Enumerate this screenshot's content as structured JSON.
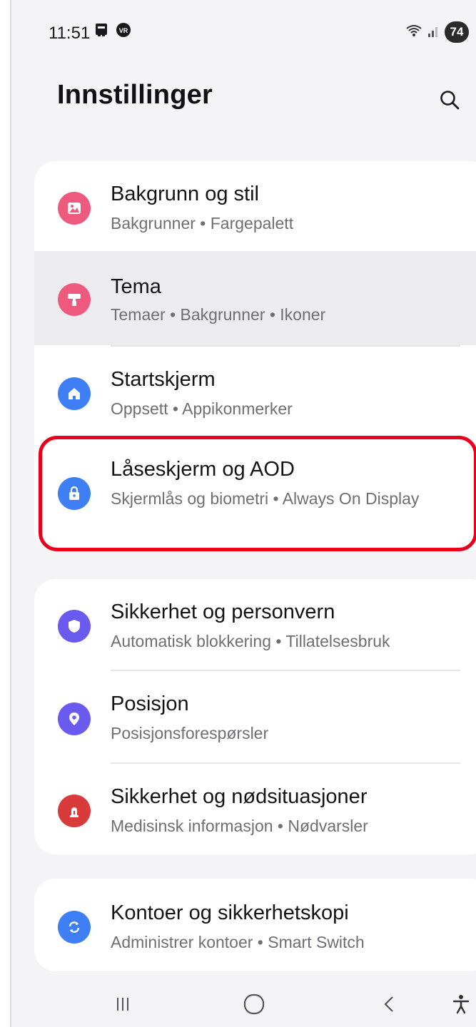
{
  "status_bar": {
    "time": "11:51",
    "battery": "74",
    "notification_icons": [
      "sim-card-icon",
      "vr-badge-icon"
    ],
    "system_icons": [
      "wifi-icon",
      "signal-icon",
      "battery-icon"
    ]
  },
  "header": {
    "title": "Innstillinger",
    "search_icon": "search-icon"
  },
  "groups": [
    {
      "items": [
        {
          "title": "Bakgrunn og stil",
          "subtitle": "Bakgrunner • Fargepalett",
          "icon": "image-icon",
          "color": "#ee5a7e"
        },
        {
          "title": "Tema",
          "subtitle": "Temaer • Bakgrunner • Ikoner",
          "icon": "paint-roller-icon",
          "color": "#ee5a7e"
        },
        {
          "title": "Startskjerm",
          "subtitle": "Oppsett • Appikonmerker",
          "icon": "home-icon",
          "color": "#3f7ff5"
        },
        {
          "title": "Låseskjerm og AOD",
          "subtitle": "Skjermlås og biometri • Always On Display",
          "icon": "lock-icon",
          "color": "#3f7ff5"
        }
      ]
    },
    {
      "items": [
        {
          "title": "Sikkerhet og personvern",
          "subtitle": "Automatisk blokkering • Tillatelsesbruk",
          "icon": "shield-icon",
          "color": "#6a5af0"
        },
        {
          "title": "Posisjon",
          "subtitle": "Posisjonsforespørsler",
          "icon": "location-pin-icon",
          "color": "#6a5af0"
        },
        {
          "title": "Sikkerhet og nødsituasjoner",
          "subtitle": "Medisinsk informasjon • Nødvarsler",
          "icon": "emergency-light-icon",
          "color": "#d93b3b"
        }
      ]
    },
    {
      "items": [
        {
          "title": "Kontoer og sikkerhetskopi",
          "subtitle": "Administrer kontoer • Smart Switch",
          "icon": "sync-icon",
          "color": "#3f7ff5"
        }
      ]
    }
  ],
  "nav_bar": {
    "buttons": [
      "recents-icon",
      "home-circle-icon",
      "back-icon",
      "accessibility-icon"
    ]
  },
  "colors": {
    "background": "#f4f4f6",
    "card": "#ffffff",
    "highlight_frame": "#e8001c",
    "pressed_row": "#ececee"
  }
}
